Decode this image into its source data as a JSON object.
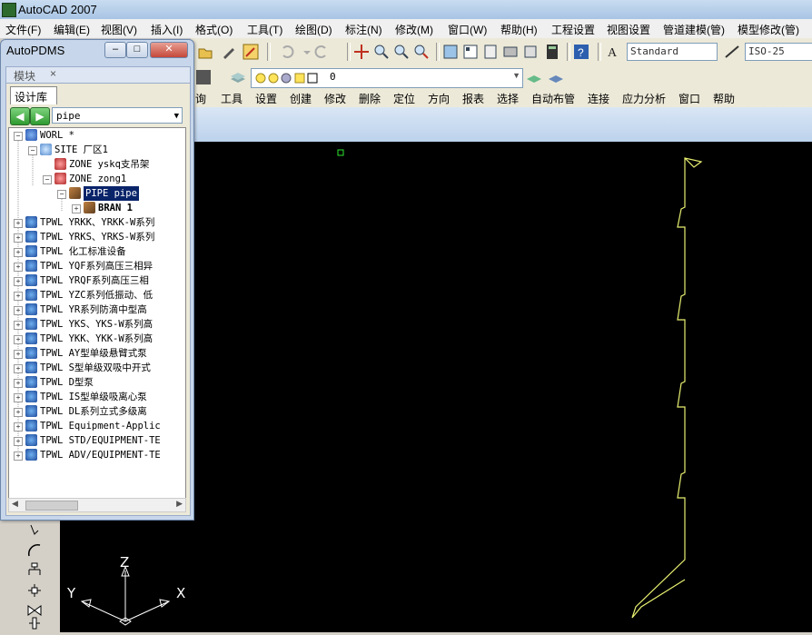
{
  "app": {
    "title": "AutoCAD 2007"
  },
  "menubar": {
    "items": [
      "文件(F)",
      "编辑(E)",
      "视图(V)",
      "插入(I)",
      "格式(O)",
      "工具(T)",
      "绘图(D)",
      "标注(N)",
      "修改(M)",
      "窗口(W)",
      "帮助(H)",
      "工程设置",
      "视图设置",
      "管道建模(管)",
      "模型修改(管)"
    ]
  },
  "toolbar": {
    "text_style": "Standard",
    "dim_style": "ISO-25",
    "layer": "0"
  },
  "pdms_menu": {
    "items": [
      "询",
      "工具",
      "设置",
      "创建",
      "修改",
      "删除",
      "定位",
      "方向",
      "报表",
      "选择",
      "自动布管",
      "连接",
      "应力分析",
      "窗口",
      "帮助"
    ]
  },
  "pdms_window": {
    "title": "AutoPDMS",
    "panel_title": "模块",
    "panel_close": "×",
    "tab": "设计库",
    "combo_value": "pipe",
    "tree": [
      {
        "text": "WORL *"
      },
      {
        "text": "SITE 厂区1"
      },
      {
        "text": "ZONE yskq支吊架"
      },
      {
        "text": "ZONE zong1"
      },
      {
        "text": "PIPE pipe"
      },
      {
        "text": "BRAN 1"
      },
      {
        "text": "TPWL YRKK、YRKK-W系列"
      },
      {
        "text": "TPWL YRKS、YRKS-W系列"
      },
      {
        "text": "TPWL 化工标准设备"
      },
      {
        "text": "TPWL YQF系列高压三相异"
      },
      {
        "text": "TPWL YRQF系列高压三相"
      },
      {
        "text": "TPWL YZC系列低振动、低"
      },
      {
        "text": "TPWL YR系列防滴中型高"
      },
      {
        "text": "TPWL YKS、YKS-W系列高"
      },
      {
        "text": "TPWL YKK、YKK-W系列高"
      },
      {
        "text": "TPWL AY型单级悬臂式泵"
      },
      {
        "text": "TPWL S型单级双吸中开式"
      },
      {
        "text": "TPWL D型泵"
      },
      {
        "text": "TPWL IS型单级吸离心泵"
      },
      {
        "text": "TPWL DL系列立式多级离"
      },
      {
        "text": "TPWL Equipment-Applic"
      },
      {
        "text": "TPWL STD/EQUIPMENT-TE"
      },
      {
        "text": "TPWL ADV/EQUIPMENT-TE"
      }
    ]
  },
  "ucs": {
    "x": "X",
    "y": "Y",
    "z": "Z"
  },
  "colors": {
    "canvas": "#000000",
    "pipe_line": "#e8f070",
    "selection": "#0a246a"
  }
}
